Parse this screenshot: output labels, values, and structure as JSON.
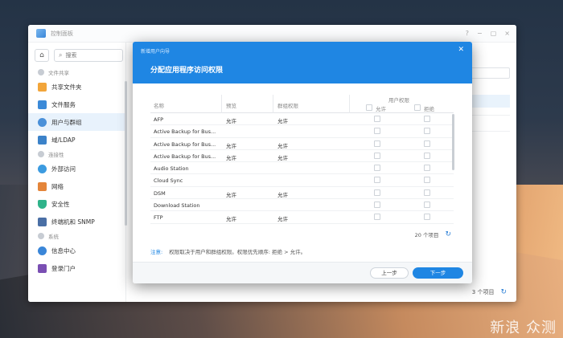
{
  "control_panel": {
    "title": "控制面板",
    "search_placeholder": "搜索",
    "groups": [
      {
        "label": "文件共享",
        "items": [
          {
            "label": "共享文件夹",
            "icon": "folder-icon",
            "color": "#f2a53a"
          },
          {
            "label": "文件服务",
            "icon": "file-services-icon",
            "color": "#3c8ad8"
          },
          {
            "label": "用户与群组",
            "icon": "users-icon",
            "color": "#4a90d9",
            "active": true
          },
          {
            "label": "域/LDAP",
            "icon": "domain-icon",
            "color": "#3b82c9"
          }
        ]
      },
      {
        "label": "连接性",
        "items": [
          {
            "label": "外部访问",
            "icon": "external-access-icon",
            "color": "#3c9be0"
          },
          {
            "label": "网络",
            "icon": "network-icon",
            "color": "#e4853a"
          },
          {
            "label": "安全性",
            "icon": "shield-icon",
            "color": "#2fb38a"
          },
          {
            "label": "终端机和 SNMP",
            "icon": "terminal-icon",
            "color": "#4a6fa5"
          }
        ]
      },
      {
        "label": "系统",
        "items": [
          {
            "label": "信息中心",
            "icon": "info-icon",
            "color": "#3a86d8"
          },
          {
            "label": "登录门户",
            "icon": "login-portal-icon",
            "color": "#7a4fb3"
          }
        ]
      }
    ],
    "footer_count": "3 个项目"
  },
  "dialog": {
    "small_title": "新增用户向导",
    "title": "分配应用程序访问权限",
    "columns": {
      "name": "名称",
      "preview": "预览",
      "group_perm": "群组权限",
      "user_perm": "用户权限",
      "allow": "允许",
      "deny": "拒绝"
    },
    "rows": [
      {
        "name": "AFP",
        "preview": "允许",
        "group": "允许"
      },
      {
        "name": "Active Backup for Bus...",
        "preview": "",
        "group": ""
      },
      {
        "name": "Active Backup for Bus...",
        "preview": "允许",
        "group": "允许"
      },
      {
        "name": "Active Backup for Bus...",
        "preview": "允许",
        "group": "允许"
      },
      {
        "name": "Audio Station",
        "preview": "",
        "group": ""
      },
      {
        "name": "Cloud Sync",
        "preview": "",
        "group": ""
      },
      {
        "name": "DSM",
        "preview": "允许",
        "group": "允许"
      },
      {
        "name": "Download Station",
        "preview": "",
        "group": ""
      },
      {
        "name": "FTP",
        "preview": "允许",
        "group": "允许"
      }
    ],
    "item_count": "20 个项目",
    "note_label": "注意:",
    "note_text": "权限取决于用户和群组权限。权限优先顺序: 拒绝 > 允许。",
    "prev_button": "上一步",
    "next_button": "下一步"
  },
  "watermark": {
    "text": "新浪 众测",
    "sub": "新 浪"
  }
}
